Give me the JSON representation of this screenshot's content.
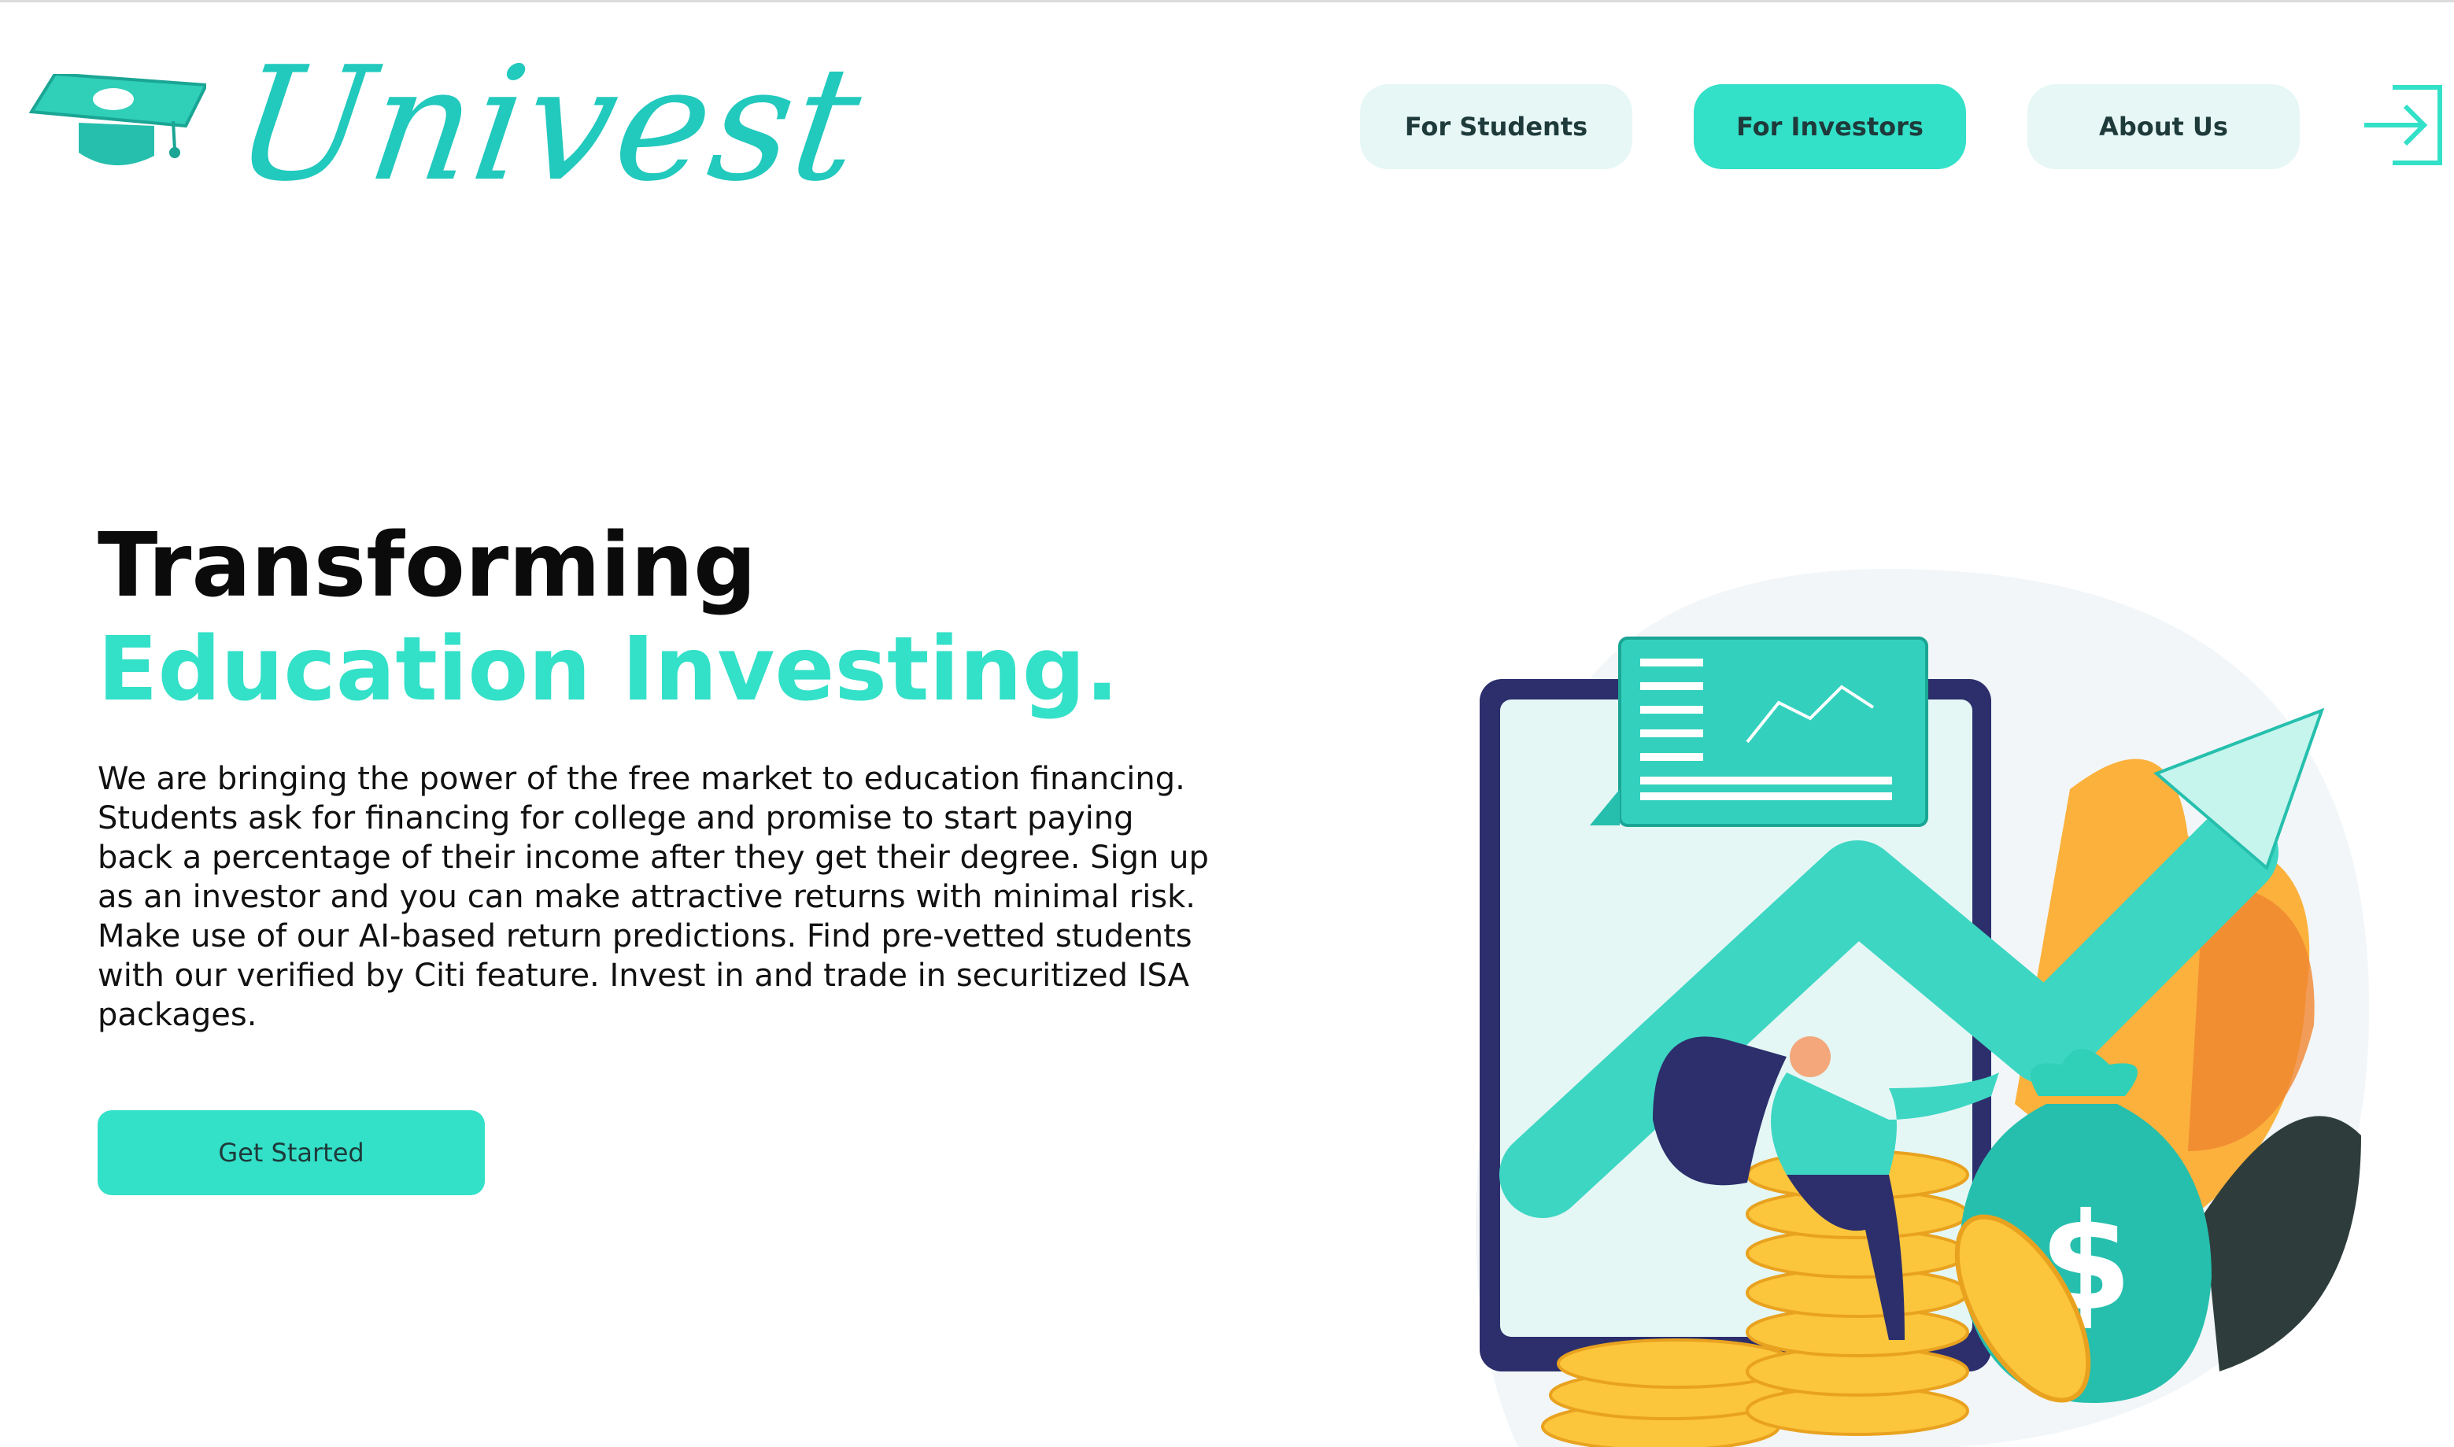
{
  "brand": {
    "name": "Univest"
  },
  "nav": {
    "items": [
      {
        "label": "For Students"
      },
      {
        "label": "For Investors",
        "active": true
      },
      {
        "label": "About Us"
      }
    ]
  },
  "hero": {
    "title_line1": "Transforming",
    "title_line2": "Education Investing.",
    "description": "We are bringing the power of the free market to education financing.  Students ask for financing for college and promise to start paying back a percentage of their income after they get their degree. Sign up as an investor and you can make attractive returns with minimal risk.  Make use of our AI-based return predictions. Find pre-vetted students with our verified by Citi feature. Invest in and trade in securitized ISA packages.",
    "cta_label": "Get Started"
  },
  "icons": {
    "logo": "graduation-cap-icon",
    "login": "login-arrow-icon",
    "illustration": "investment-growth-illustration"
  },
  "colors": {
    "accent": "#33e0c8",
    "accent_light": "#e6f7f5",
    "heading": "#0b0b0b",
    "text": "#111111"
  }
}
